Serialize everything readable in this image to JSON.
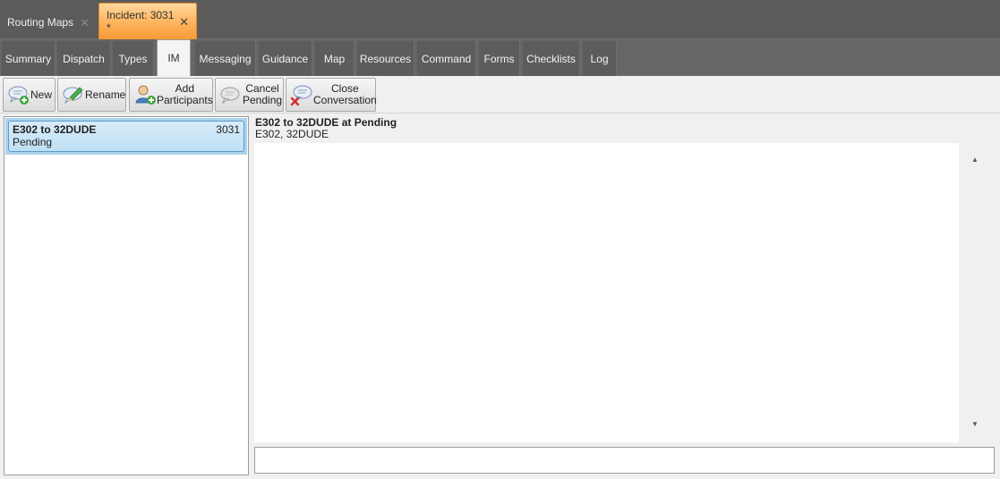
{
  "doc_tabs": [
    {
      "label": "Routing Maps",
      "close": "✕"
    },
    {
      "label": "Incident: 3031 *",
      "close": "✕"
    }
  ],
  "sub_tabs": [
    "Summary",
    "Dispatch",
    "Types",
    "IM",
    "Messaging",
    "Guidance",
    "Map",
    "Resources",
    "Command",
    "Forms",
    "Checklists",
    "Log"
  ],
  "active_sub_tab": "IM",
  "toolbar": {
    "new": "New",
    "rename": "Rename",
    "add_participants_1": "Add",
    "add_participants_2": "Participants",
    "cancel_pending_1": "Cancel",
    "cancel_pending_2": "Pending",
    "close_conversation_1": "Close",
    "close_conversation_2": "Conversation"
  },
  "conversations": [
    {
      "title": "E302 to 32DUDE",
      "status": "Pending",
      "incident": "3031"
    }
  ],
  "detail": {
    "title": "E302 to 32DUDE at Pending",
    "participants": "E302, 32DUDE"
  },
  "scroll": {
    "up": "▲",
    "down": "▼"
  },
  "colors": {
    "active_doc_tab": "#ffb866",
    "selected_item": "#bfe0f5"
  }
}
